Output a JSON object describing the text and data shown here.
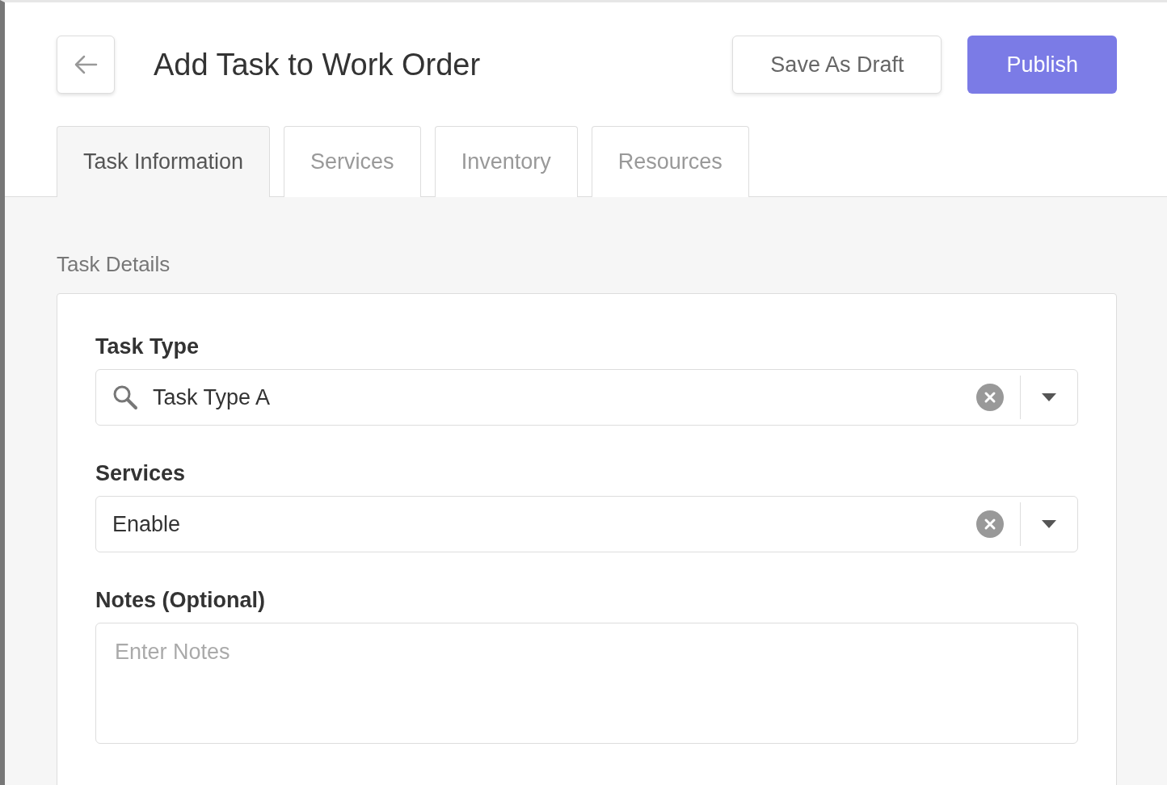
{
  "header": {
    "title": "Add Task to Work Order",
    "buttons": [
      {
        "label": "Save As Draft",
        "kind": "secondary"
      },
      {
        "label": "Publish",
        "kind": "primary"
      }
    ]
  },
  "tabs": [
    {
      "label": "Task Information",
      "selected": true
    },
    {
      "label": "Services",
      "selected": false
    },
    {
      "label": "Inventory",
      "selected": false
    },
    {
      "label": "Resources",
      "selected": false
    }
  ],
  "section": {
    "title": "Task Details",
    "fields": [
      {
        "label": "Task Type",
        "kind": "search-select",
        "value": "Task Type A"
      },
      {
        "label": "Services",
        "kind": "select",
        "value": "Enable"
      },
      {
        "label": "Notes (Optional)",
        "kind": "textarea",
        "placeholder": "Enter Notes"
      }
    ]
  }
}
